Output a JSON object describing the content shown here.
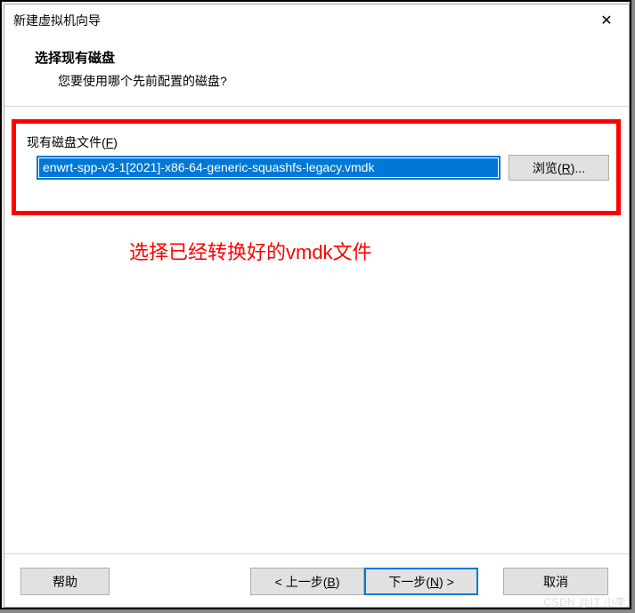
{
  "titlebar": {
    "title": "新建虚拟机向导"
  },
  "banner": {
    "heading": "选择现有磁盘",
    "sub": "您要使用哪个先前配置的磁盘?"
  },
  "field": {
    "label_prefix": "现有磁盘文件(",
    "label_mn": "F",
    "label_suffix": ")",
    "value": "enwrt-spp-v3-1[2021]-x86-64-generic-squashfs-legacy.vmdk"
  },
  "browse": {
    "prefix": "浏览(",
    "mn": "R",
    "suffix": ")..."
  },
  "annotation": "选择已经转换好的vmdk文件",
  "buttons": {
    "help": "帮助",
    "back_prefix": "< 上一步(",
    "back_mn": "B",
    "back_suffix": ")",
    "next_prefix": "下一步(",
    "next_mn": "N",
    "next_suffix": ") >",
    "cancel": "取消"
  },
  "watermark": "CSDN @IT 小李"
}
